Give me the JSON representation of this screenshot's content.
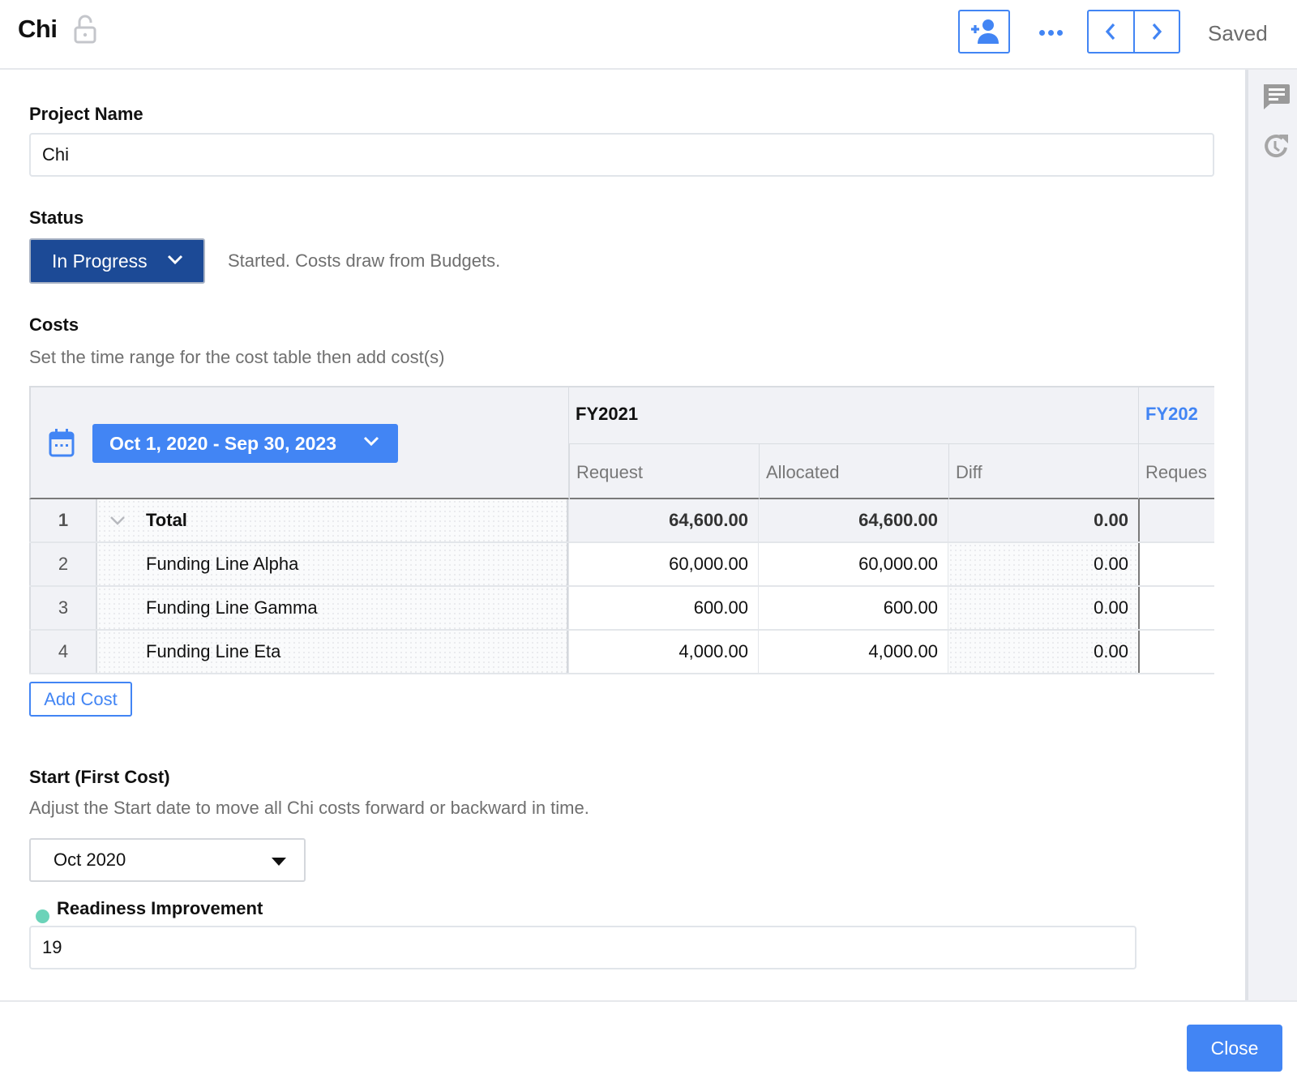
{
  "header": {
    "title": "Chi",
    "saved_status": "Saved",
    "icons": {
      "lock": "lock-open-icon",
      "add_user": "add-user-icon",
      "more": "more-horizontal-icon",
      "prev": "chevron-left-icon",
      "next": "chevron-right-icon"
    }
  },
  "rail": {
    "icons": [
      "comment-icon",
      "history-icon"
    ]
  },
  "form": {
    "project_name": {
      "label": "Project Name",
      "value": "Chi"
    },
    "status": {
      "label": "Status",
      "selected": "In Progress",
      "description": "Started. Costs draw from Budgets."
    },
    "costs": {
      "label": "Costs",
      "help": "Set the time range for the cost table then add cost(s)",
      "date_range": "Oct 1, 2020 - Sep 30, 2023",
      "fiscal_years": [
        {
          "label": "FY2021",
          "columns": [
            "Request",
            "Allocated",
            "Diff"
          ]
        },
        {
          "label": "FY202",
          "columns": [
            "Reques"
          ]
        }
      ],
      "rows": [
        {
          "num": "1",
          "name": "Total",
          "request": "64,600.00",
          "allocated": "64,600.00",
          "diff": "0.00",
          "is_total": true
        },
        {
          "num": "2",
          "name": "Funding Line Alpha",
          "request": "60,000.00",
          "allocated": "60,000.00",
          "diff": "0.00"
        },
        {
          "num": "3",
          "name": "Funding Line Gamma",
          "request": "600.00",
          "allocated": "600.00",
          "diff": "0.00"
        },
        {
          "num": "4",
          "name": "Funding Line Eta",
          "request": "4,000.00",
          "allocated": "4,000.00",
          "diff": "0.00"
        }
      ],
      "add_button": "Add Cost"
    },
    "start": {
      "label": "Start (First Cost)",
      "help": "Adjust the Start date to move all Chi costs forward or backward in time.",
      "selected": "Oct 2020"
    },
    "readiness": {
      "label": "Readiness Improvement",
      "value": "19",
      "indicator_color": "#6bd3b9"
    }
  },
  "footer": {
    "close_label": "Close"
  },
  "colors": {
    "accent": "#4285f4",
    "status_bg": "#1c4a96",
    "muted_text": "#6f6f6f"
  }
}
